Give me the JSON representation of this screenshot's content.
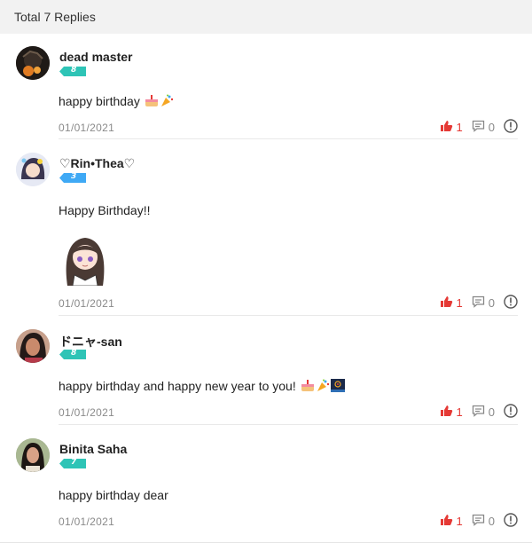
{
  "header": {
    "title": "Total 7 Replies"
  },
  "replies": [
    {
      "name": "dead master",
      "level": "8",
      "level_color": "#2ec4b6",
      "text": "happy birthday",
      "date": "01/01/2021",
      "likes": "1",
      "comments": "0"
    },
    {
      "name": "♡Rin•Thea♡",
      "level": "3",
      "level_color": "#3fa9f5",
      "text": "Happy Birthday!!",
      "date": "01/01/2021",
      "likes": "1",
      "comments": "0"
    },
    {
      "name": "ドニャ-san",
      "level": "8",
      "level_color": "#2ec4b6",
      "text": "happy birthday and happy new year to you!",
      "date": "01/01/2021",
      "likes": "1",
      "comments": "0"
    },
    {
      "name": "Binita Saha",
      "level": "7",
      "level_color": "#2ec4b6",
      "text": "happy birthday dear",
      "date": "01/01/2021",
      "likes": "1",
      "comments": "0"
    }
  ],
  "icons": {
    "like": "thumbs-up-icon",
    "comment": "comment-icon",
    "report": "report-icon"
  },
  "colors": {
    "like_red": "#e53935",
    "muted": "#888888"
  }
}
